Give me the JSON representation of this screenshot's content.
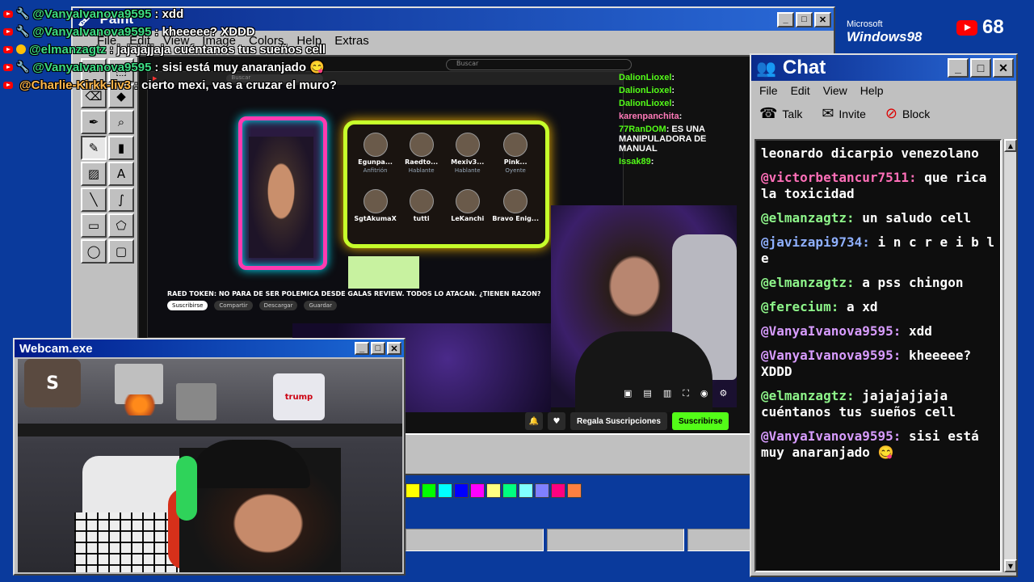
{
  "paint": {
    "title": "Paint",
    "menu": [
      "File",
      "Edit",
      "View",
      "Image",
      "Colors",
      "Help",
      "Extras"
    ],
    "tools": [
      "✂",
      "⬚",
      "⌫",
      "◆",
      "✒",
      "⌕",
      "✎",
      "▮",
      "▨",
      "A",
      "╲",
      "∫",
      "▭",
      "⬠",
      "◯",
      "▢"
    ],
    "palette": [
      "#ffff00",
      "#00ff00",
      "#00ffff",
      "#0000ff",
      "#ff00ff",
      "#ffff80",
      "#00ff80",
      "#80ffff",
      "#8080ff",
      "#ff0080",
      "#ff8040"
    ]
  },
  "stream": {
    "search_placeholder": "Buscar",
    "video_title": "RAED TOKEN: NO PARA DE SER POLEMICA DESDE GALAS REVIEW. TODOS LO ATACAN. ¿TIENEN RAZON?",
    "channel_sub": "Suscribirse",
    "actions": [
      "Compartir",
      "Descargar",
      "Guardar"
    ],
    "guests": [
      {
        "name": "Egunpa...",
        "role": "Anfitrión"
      },
      {
        "name": "Raedto...",
        "role": "Hablante"
      },
      {
        "name": "Mexiv3...",
        "role": "Hablante"
      },
      {
        "name": "Pink...",
        "role": "Oyente"
      },
      {
        "name": "SgtAkumaX",
        "role": ""
      },
      {
        "name": "tutti",
        "role": ""
      },
      {
        "name": "LeKanchi",
        "role": ""
      },
      {
        "name": "Bravo Enig...",
        "role": ""
      }
    ],
    "kick_chat": [
      {
        "user": "DalionLioxel",
        "text": ":"
      },
      {
        "user": "DalionLioxel",
        "text": ":"
      },
      {
        "user": "DalionLioxel",
        "text": ":"
      },
      {
        "user": "karenpanchita",
        "text": ":"
      },
      {
        "user": "77RanDOM",
        "text": ": ES UNA MANIPULADORA DE MANUAL"
      },
      {
        "user": "Issak89",
        "text": ":"
      }
    ],
    "regala": "Regala Suscripciones",
    "suscribirse": "Suscribirse"
  },
  "overlay_chat": [
    {
      "user": "@VanyaIvanova9595",
      "text": ": xdd",
      "color": "green"
    },
    {
      "user": "@VanyaIvanova9595",
      "text": ": kheeeee? XDDD",
      "color": "green"
    },
    {
      "user": "@elmanzagtz",
      "text": ": jajajajjaja cuéntanos tus sueños cell",
      "color": "green"
    },
    {
      "user": "@VanyaIvanova9595",
      "text": ": sisi está muy anaranjado 😋",
      "color": "green"
    },
    {
      "user": "@Charlie-Kirkk-liv3",
      "text": ": cierto mexi, vas a cruzar el muro?",
      "color": "orange"
    }
  ],
  "brand": {
    "microsoft": "Microsoft",
    "windows": "Windows98",
    "viewers": "68"
  },
  "chat": {
    "title": "Chat",
    "menu": [
      "File",
      "Edit",
      "View",
      "Help"
    ],
    "tools": [
      {
        "label": "Talk",
        "icon": "☎"
      },
      {
        "label": "Invite",
        "icon": "✉"
      },
      {
        "label": "Block",
        "icon": "⊘"
      }
    ],
    "messages": [
      {
        "user": "",
        "text": "leonardo dicarpio venezolano",
        "color": "green"
      },
      {
        "user": "@victorbetancur7511:",
        "text": " que rica la toxicidad",
        "color": "pink"
      },
      {
        "user": "@elmanzagtz:",
        "text": " un saludo cell",
        "color": "green"
      },
      {
        "user": "@javizapi9734:",
        "text": " i n c r e i b l e",
        "color": "blue"
      },
      {
        "user": "@elmanzagtz:",
        "text": " a pss chingon",
        "color": "green"
      },
      {
        "user": "@ferecium:",
        "text": " a xd",
        "color": "green"
      },
      {
        "user": "@VanyaIvanova9595:",
        "text": " xdd",
        "color": "violet"
      },
      {
        "user": "@VanyaIvanova9595:",
        "text": " kheeeee? XDDD",
        "color": "violet"
      },
      {
        "user": "@elmanzagtz:",
        "text": " jajajajjaja cuéntanos tus sueños cell",
        "color": "green"
      },
      {
        "user": "@VanyaIvanova9595:",
        "text": " sisi está muy anaranjado 😋",
        "color": "violet"
      }
    ]
  },
  "webcam": {
    "title": "Webcam.exe",
    "rolls_label": "trump"
  }
}
